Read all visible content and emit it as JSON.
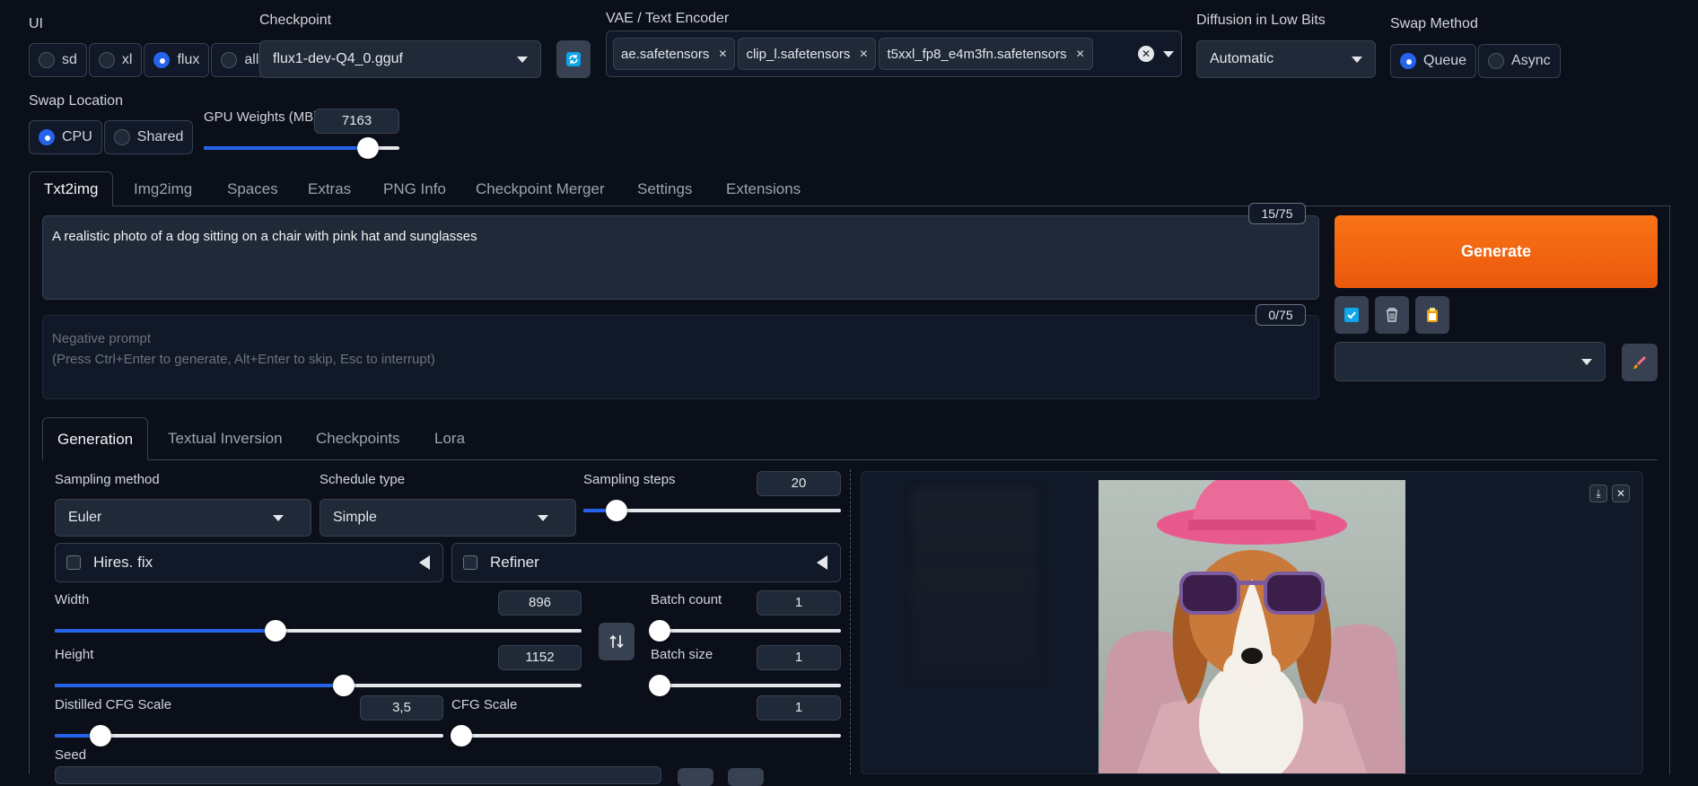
{
  "top": {
    "ui_label": "UI",
    "ui_options": [
      "sd",
      "xl",
      "flux",
      "all"
    ],
    "ui_selected": "flux",
    "checkpoint_label": "Checkpoint",
    "checkpoint_value": "flux1-dev-Q4_0.gguf",
    "vae_label": "VAE / Text Encoder",
    "vae_chips": [
      "ae.safetensors",
      "clip_l.safetensors",
      "t5xxl_fp8_e4m3fn.safetensors"
    ],
    "lowbits_label": "Diffusion in Low Bits",
    "lowbits_value": "Automatic",
    "swap_method_label": "Swap Method",
    "swap_method_options": [
      "Queue",
      "Async"
    ],
    "swap_method_selected": "Queue",
    "swap_location_label": "Swap Location",
    "swap_location_options": [
      "CPU",
      "Shared"
    ],
    "swap_location_selected": "CPU",
    "gpu_weights_label": "GPU Weights (MB)",
    "gpu_weights_value": "7163",
    "gpu_weights_fraction": 0.84
  },
  "tabs": [
    "Txt2img",
    "Img2img",
    "Spaces",
    "Extras",
    "PNG Info",
    "Checkpoint Merger",
    "Settings",
    "Extensions"
  ],
  "active_tab": "Txt2img",
  "prompt": {
    "text": "A realistic photo of a dog sitting on a chair with pink hat and sunglasses",
    "token_count": "15/75",
    "negative_placeholder": "Negative prompt\n(Press Ctrl+Enter to generate, Alt+Enter to skip, Esc to interrupt)",
    "negative_token_count": "0/75"
  },
  "generate_label": "Generate",
  "subtabs": [
    "Generation",
    "Textual Inversion",
    "Checkpoints",
    "Lora"
  ],
  "active_subtab": "Generation",
  "gen": {
    "sampling_method_label": "Sampling method",
    "sampling_method_value": "Euler",
    "schedule_type_label": "Schedule type",
    "schedule_type_value": "Simple",
    "sampling_steps_label": "Sampling steps",
    "sampling_steps_value": "20",
    "hires_label": "Hires. fix",
    "refiner_label": "Refiner",
    "width_label": "Width",
    "width_value": "896",
    "height_label": "Height",
    "height_value": "1152",
    "batch_count_label": "Batch count",
    "batch_count_value": "1",
    "batch_size_label": "Batch size",
    "batch_size_value": "1",
    "distilled_cfg_label": "Distilled CFG Scale",
    "distilled_cfg_value": "3,5",
    "cfg_label": "CFG Scale",
    "cfg_value": "1",
    "seed_label": "Seed"
  },
  "colors": {
    "generate": "#f97316",
    "accent": "#2563eb",
    "background": "#0b0f19"
  }
}
